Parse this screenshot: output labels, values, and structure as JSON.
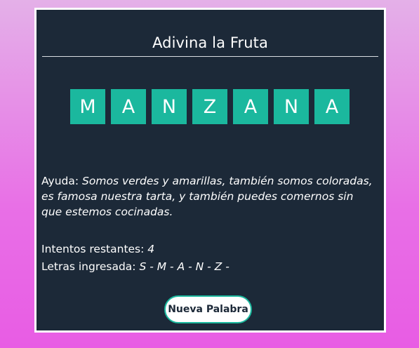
{
  "game": {
    "title": "Adivina la Fruta",
    "word_letters": [
      "M",
      "A",
      "N",
      "Z",
      "A",
      "N",
      "A"
    ],
    "help_label": "Ayuda:",
    "help_text": "Somos verdes y amarillas, también somos coloradas, es famosa nuestra tarta, y también puedes comernos sin que estemos cocinadas.",
    "attempts_label": "Intentos restantes:",
    "attempts_value": "4",
    "letters_label": "Letras ingresada:",
    "letters_value": "S - M - A - N - Z -",
    "new_word_button": "Nueva Palabra"
  },
  "colors": {
    "card_background": "#1c2938",
    "tile_accent": "#1bb89e",
    "page_gradient_top": "#e4b0e8",
    "page_gradient_bottom": "#e85ce4"
  }
}
